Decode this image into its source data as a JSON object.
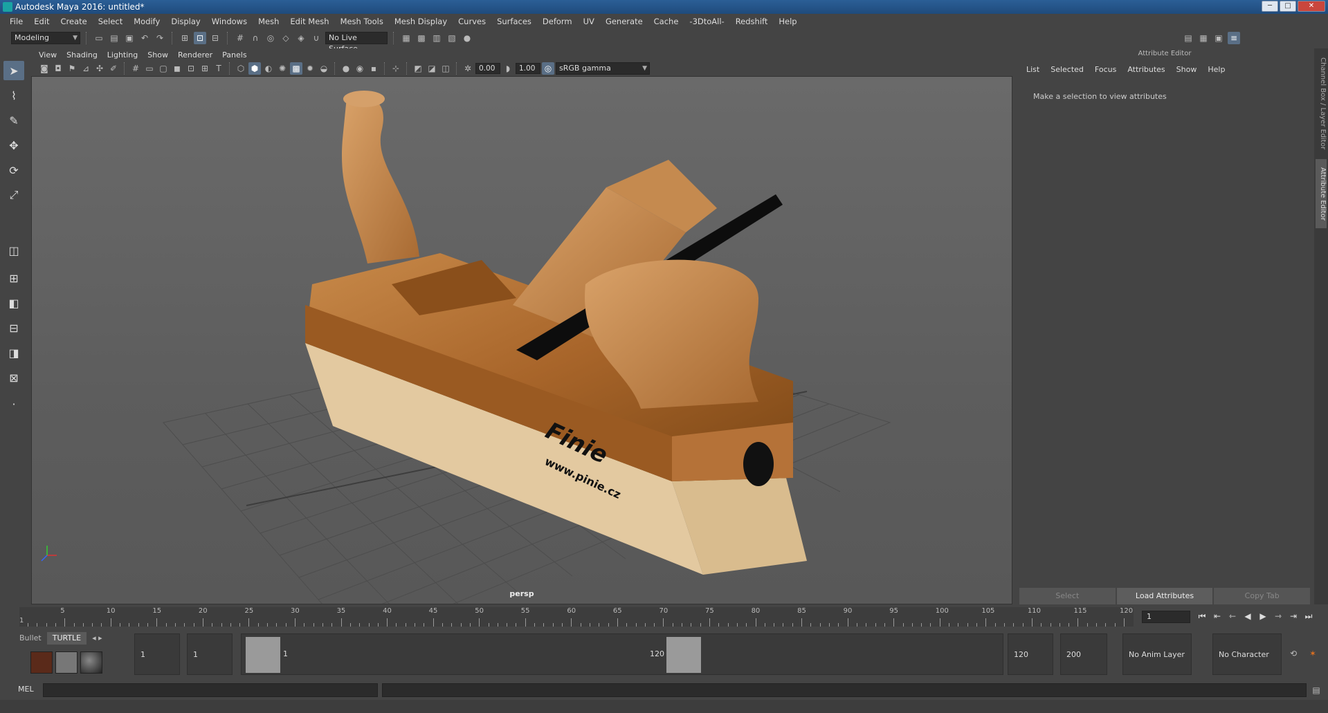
{
  "window": {
    "title": "Autodesk Maya 2016: untitled*",
    "buttons": [
      "─",
      "□",
      "✕"
    ]
  },
  "menubar": [
    "File",
    "Edit",
    "Create",
    "Select",
    "Modify",
    "Display",
    "Windows",
    "Mesh",
    "Edit Mesh",
    "Mesh Tools",
    "Mesh Display",
    "Curves",
    "Surfaces",
    "Deform",
    "UV",
    "Generate",
    "Cache",
    "-3DtoAll-",
    "Redshift",
    "Help"
  ],
  "toolbar": {
    "mode": "Modeling",
    "live_surface": "No Live Surface"
  },
  "viewport": {
    "menus": [
      "View",
      "Shading",
      "Lighting",
      "Show",
      "Renderer",
      "Panels"
    ],
    "exposure": "0.00",
    "gamma": "1.00",
    "color_space": "sRGB gamma",
    "camera": "persp",
    "logo_text": "Finie",
    "logo_url": "www.pinie.cz"
  },
  "attribute_editor": {
    "title": "Attribute Editor",
    "menus": [
      "List",
      "Selected",
      "Focus",
      "Attributes",
      "Show",
      "Help"
    ],
    "message": "Make a selection to view attributes",
    "buttons": [
      "Select",
      "Load Attributes",
      "Copy Tab"
    ]
  },
  "side_tabs": [
    "Channel Box / Layer Editor",
    "Attribute Editor"
  ],
  "timeline": {
    "start_label": "1",
    "ticks": [
      "5",
      "10",
      "15",
      "20",
      "25",
      "30",
      "35",
      "40",
      "45",
      "50",
      "55",
      "60",
      "65",
      "70",
      "75",
      "80",
      "85",
      "90",
      "95",
      "100",
      "105",
      "110",
      "115",
      "120"
    ],
    "current_frame": "1"
  },
  "shelf": {
    "tabs": [
      "Bullet",
      "TURTLE"
    ]
  },
  "range": {
    "anim_start": "1",
    "play_start": "1",
    "slider_start": "1",
    "slider_end": "120",
    "play_end": "120",
    "anim_end": "200",
    "anim_layer": "No Anim Layer",
    "character_set": "No Character Set"
  },
  "command_line": {
    "label": "MEL"
  }
}
